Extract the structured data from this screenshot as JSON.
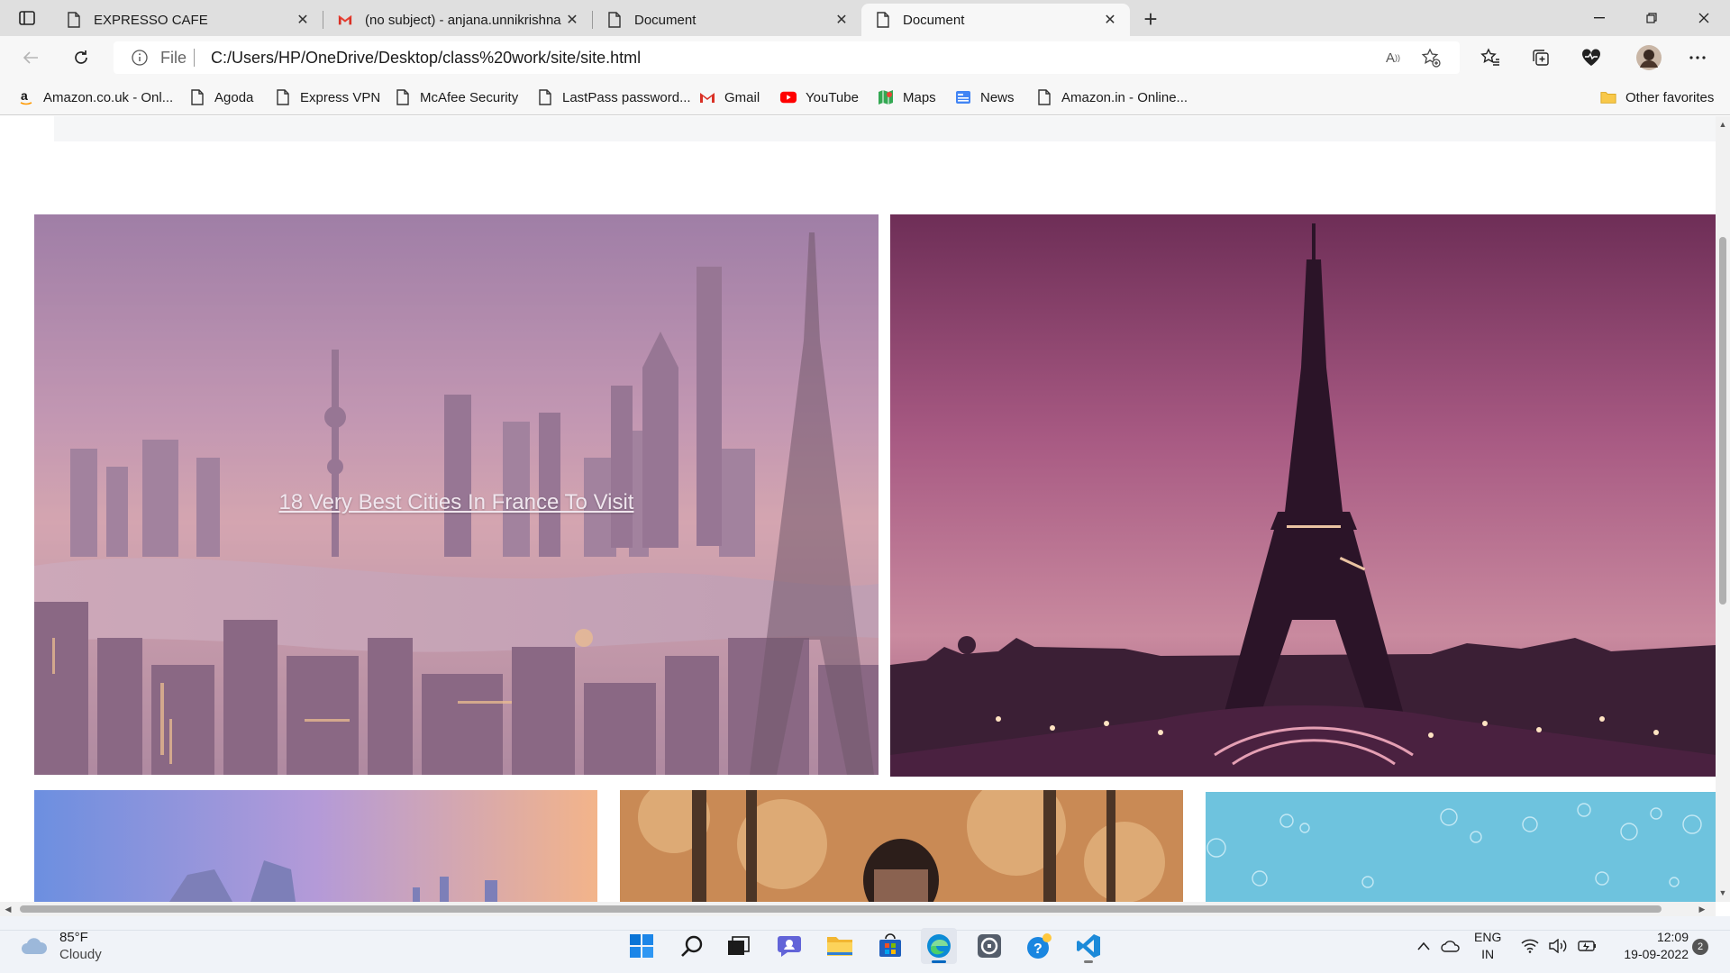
{
  "browser": {
    "tabs": [
      {
        "title": "EXPRESSO CAFE",
        "favicon": "page-icon",
        "active": false
      },
      {
        "title": "(no subject) - anjana.unnikrishna",
        "favicon": "gmail-icon",
        "active": false
      },
      {
        "title": "Document",
        "favicon": "page-icon",
        "active": false
      },
      {
        "title": "Document",
        "favicon": "page-icon",
        "active": true
      }
    ],
    "address": {
      "scheme_label": "File",
      "url": "C:/Users/HP/OneDrive/Desktop/class%20work/site/site.html"
    },
    "favorites": [
      {
        "label": "Amazon.co.uk - Onl...",
        "icon": "amazon-icon"
      },
      {
        "label": "Agoda",
        "icon": "page-icon"
      },
      {
        "label": "Express VPN",
        "icon": "page-icon"
      },
      {
        "label": "McAfee Security",
        "icon": "page-icon"
      },
      {
        "label": "LastPass password...",
        "icon": "page-icon"
      },
      {
        "label": "Gmail",
        "icon": "gmail-icon"
      },
      {
        "label": "YouTube",
        "icon": "youtube-icon"
      },
      {
        "label": "Maps",
        "icon": "maps-icon"
      },
      {
        "label": "News",
        "icon": "news-icon"
      },
      {
        "label": "Amazon.in - Online...",
        "icon": "page-icon"
      }
    ],
    "other_favorites": "Other favorites"
  },
  "page": {
    "hero_caption": "18 Very Best Cities In France To Visit"
  },
  "taskbar": {
    "weather": {
      "temp": "85°F",
      "condition": "Cloudy"
    },
    "language": {
      "line1": "ENG",
      "line2": "IN"
    },
    "clock": {
      "time": "12:09",
      "date": "19-09-2022"
    },
    "notifications": "2"
  },
  "colors": {
    "tabstrip": "#dfdfdf",
    "toolbar": "#f7f7f7",
    "taskbar": "#f0f3f8",
    "accent": "#0067c0"
  }
}
